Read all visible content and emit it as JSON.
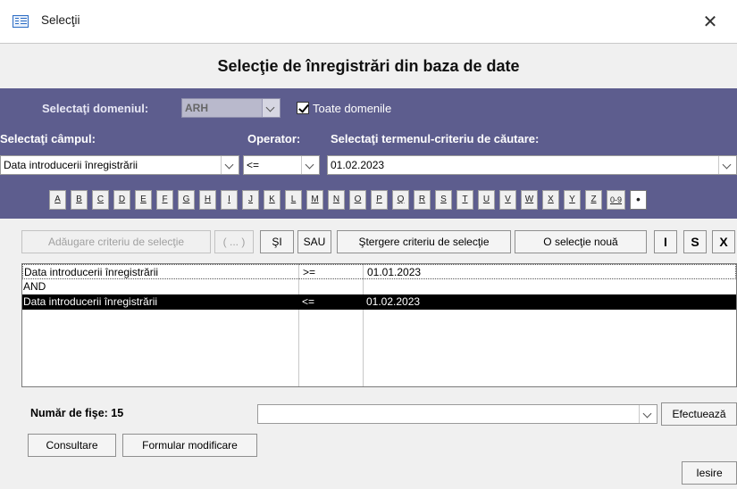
{
  "window": {
    "title": "Selecţii",
    "close_glyph": "✕"
  },
  "heading": "Selecţie de înregistrări din baza de date",
  "domain": {
    "label": "Selectaţi domeniul:",
    "value": "ARH",
    "all_domains_label": "Toate domenile",
    "all_domains_checked": true
  },
  "field": {
    "label": "Selectaţi câmpul:",
    "value": "Data introducerii înregistrării"
  },
  "operator": {
    "label": "Operator:",
    "value": "<="
  },
  "term": {
    "label": "Selectaţi termenul-criteriu de căutare:",
    "value": "01.02.2023"
  },
  "alphabet": [
    "A",
    "B",
    "C",
    "D",
    "E",
    "F",
    "G",
    "H",
    "I",
    "J",
    "K",
    "L",
    "M",
    "N",
    "O",
    "P",
    "Q",
    "R",
    "S",
    "T",
    "U",
    "V",
    "W",
    "X",
    "Y",
    "Z",
    "0-9",
    "•"
  ],
  "actions": {
    "add_criterion": "Adăugare criteriu de selecţie",
    "parens": "( ... )",
    "and": "ŞI",
    "or": "SAU",
    "delete_criterion": "Ştergere criteriu de selecţie",
    "new_selection": "O selecţie nouă",
    "i": "I",
    "s": "S",
    "x": "X"
  },
  "criteria": [
    {
      "field": "Data introducerii înregistrării",
      "operator": ">=",
      "value": "01.01.2023"
    },
    {
      "field": "AND",
      "operator": "",
      "value": ""
    },
    {
      "field": "Data introducerii înregistrării",
      "operator": "<=",
      "value": "01.02.2023",
      "selected": true
    }
  ],
  "footer": {
    "count_label": "Număr de fişe: 15",
    "run_label": "Efectuează",
    "consult_label": "Consultare",
    "edit_form_label": "Formular modificare",
    "exit_label": "Iesire"
  },
  "colors": {
    "panel": "#5d5d8e",
    "selected_row": "#000000"
  }
}
